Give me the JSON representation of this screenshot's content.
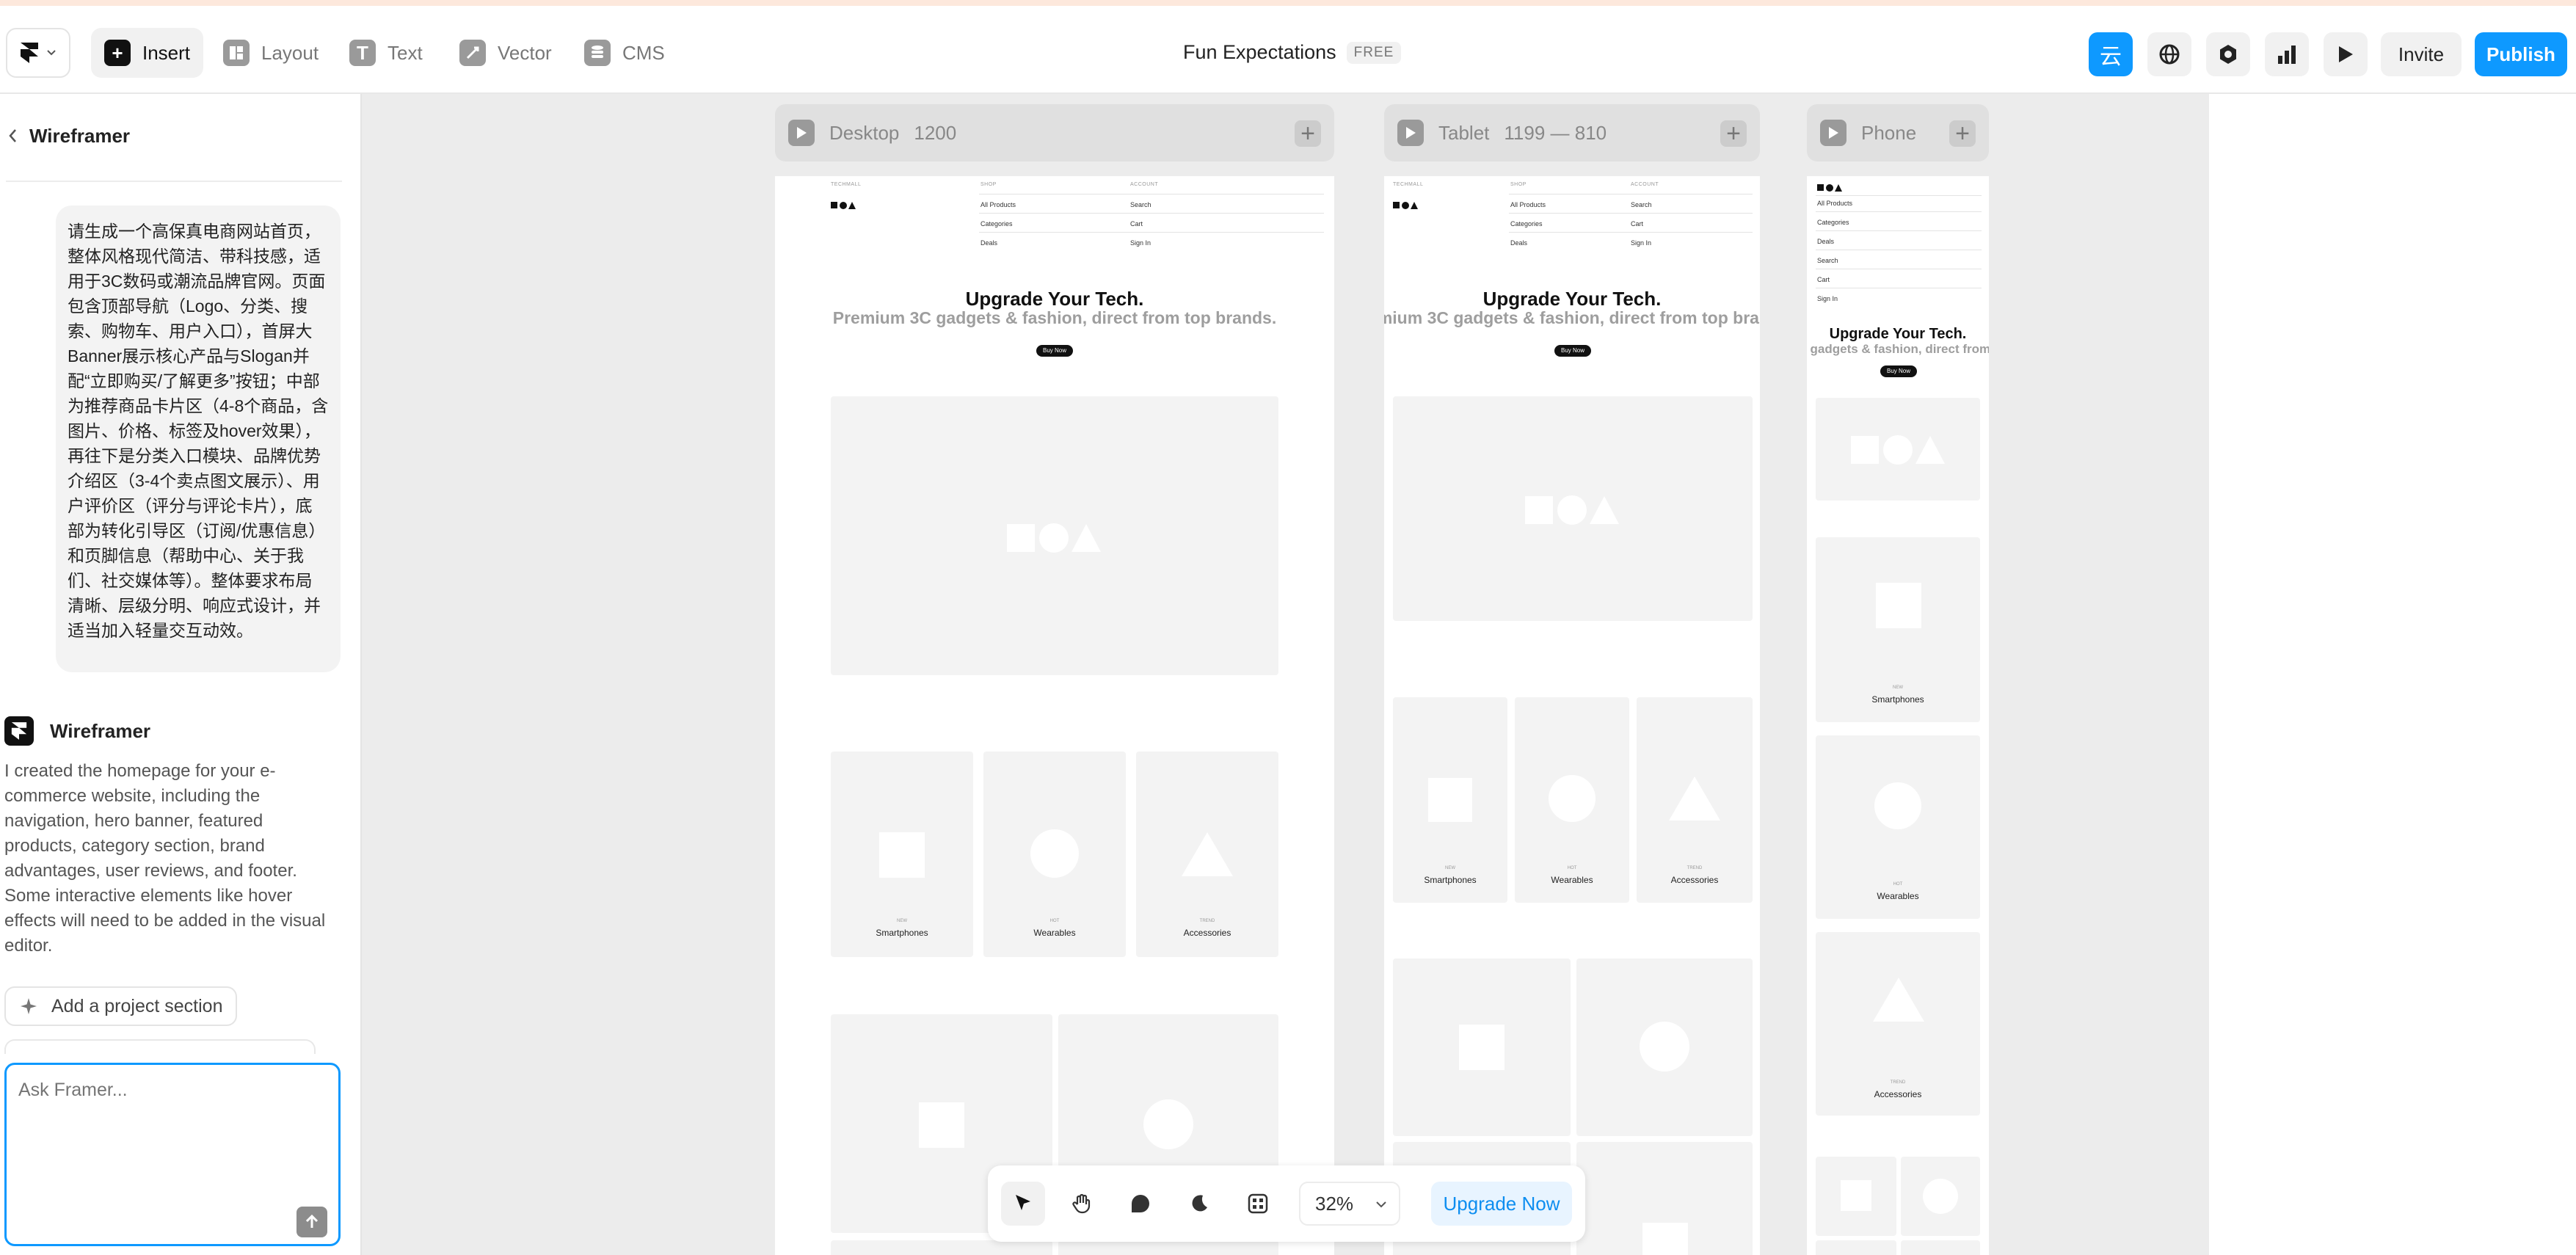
{
  "app": {
    "project_title": "Fun Expectations",
    "plan_badge": "FREE"
  },
  "toolbar": {
    "tools": [
      {
        "label": "Insert",
        "icon": "plus-icon"
      },
      {
        "label": "Layout",
        "icon": "layout-icon"
      },
      {
        "label": "Text",
        "icon": "text-icon"
      },
      {
        "label": "Vector",
        "icon": "vector-icon"
      },
      {
        "label": "CMS",
        "icon": "database-icon"
      }
    ],
    "ai_button_glyph": "云",
    "invite_label": "Invite",
    "publish_label": "Publish"
  },
  "panel": {
    "title": "Wireframer",
    "user_prompt": "请生成一个高保真电商网站首页，整体风格现代简洁、带科技感，适用于3C数码或潮流品牌官网。页面包含顶部导航（Logo、分类、搜索、购物车、用户入口），首屏大Banner展示核心产品与Slogan并配“立即购买/了解更多”按钮；中部为推荐商品卡片区（4-8个商品，含图片、价格、标签及hover效果），再往下是分类入口模块、品牌优势介绍区（3-4个卖点图文展示）、用户评价区（评分与评论卡片），底部为转化引导区（订阅/优惠信息）和页脚信息（帮助中心、关于我们、社交媒体等）。整体要求布局清晰、层级分明、响应式设计，并适当加入轻量交互动效。",
    "assistant_name": "Wireframer",
    "assistant_message": "I created the homepage for your e-commerce website, including the navigation, hero banner, featured products, category section, brand advantages, user reviews, and footer. Some interactive elements like hover effects will need to be added in the visual editor.",
    "suggestion_label": "Add a project section",
    "input_placeholder": "Ask Framer..."
  },
  "frames": {
    "desktop": {
      "name": "Desktop",
      "size": "1200"
    },
    "tablet": {
      "name": "Tablet",
      "size": "1199 — 810"
    },
    "phone": {
      "name": "Phone",
      "size": ""
    }
  },
  "site": {
    "brand_label": "TECHMALL",
    "shop_label": "SHOP",
    "account_label": "ACCOUNT",
    "nav_shop": [
      "All Products",
      "Categories",
      "Deals"
    ],
    "nav_account": [
      "Search",
      "Cart",
      "Sign In"
    ],
    "hero_title": "Upgrade Your Tech.",
    "hero_subtitle": "Premium 3C gadgets & fashion, direct from top brands.",
    "hero_button": "Buy Now",
    "categories": [
      {
        "tag": "NEW",
        "name": "Smartphones"
      },
      {
        "tag": "HOT",
        "name": "Wearables"
      },
      {
        "tag": "TREND",
        "name": "Accessories"
      }
    ]
  },
  "bottom_bar": {
    "zoom": "32%",
    "upgrade_label": "Upgrade Now"
  }
}
